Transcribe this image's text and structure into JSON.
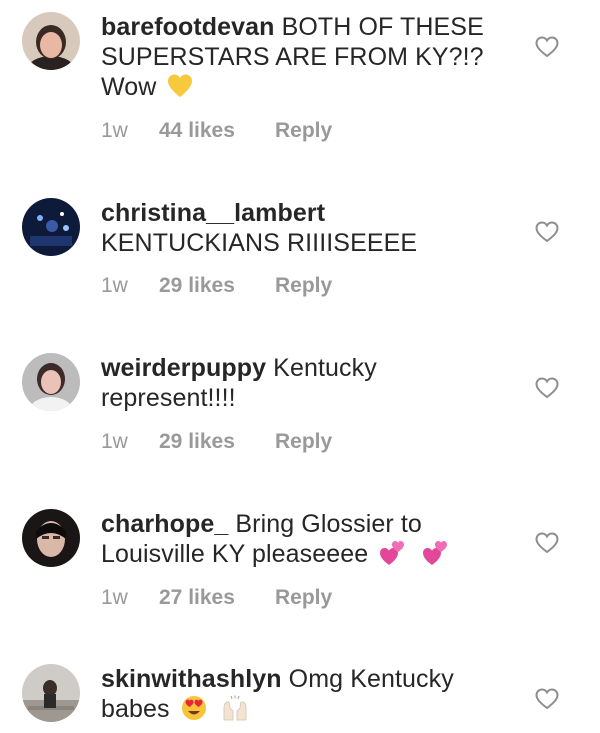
{
  "comments": [
    {
      "username": "barefootdevan",
      "text_line1": "BOTH OF THESE",
      "text_line2": "SUPERSTARS ARE FROM KY?!?",
      "text_line3": "Wow",
      "emoji": [
        "yellow-heart"
      ],
      "time": "1w",
      "likes": "44 likes",
      "reply": "Reply"
    },
    {
      "username": "christina__lambert",
      "text_line1": "",
      "text_line2": "KENTUCKIANS RIIIISEEEE",
      "emoji": [],
      "time": "1w",
      "likes": "29 likes",
      "reply": "Reply"
    },
    {
      "username": "weirderpuppy",
      "text_line1": "Kentucky",
      "text_line2": "represent!!!!",
      "emoji": [],
      "time": "1w",
      "likes": "29 likes",
      "reply": "Reply"
    },
    {
      "username": "charhope_",
      "text_line1": "Bring Glossier to",
      "text_line2": "Louisville KY pleaseeee",
      "emoji": [
        "two-hearts",
        "two-hearts"
      ],
      "time": "1w",
      "likes": "27 likes",
      "reply": "Reply"
    },
    {
      "username": "skinwithashlyn",
      "text_line1": "Omg Kentucky",
      "text_line2": "babes",
      "emoji": [
        "heart-eyes-face",
        "raising-hands"
      ],
      "time": "",
      "likes": "",
      "reply": ""
    }
  ],
  "colors": {
    "text": "#262626",
    "meta": "#999999",
    "heart_outline": "#8e8e8e"
  }
}
